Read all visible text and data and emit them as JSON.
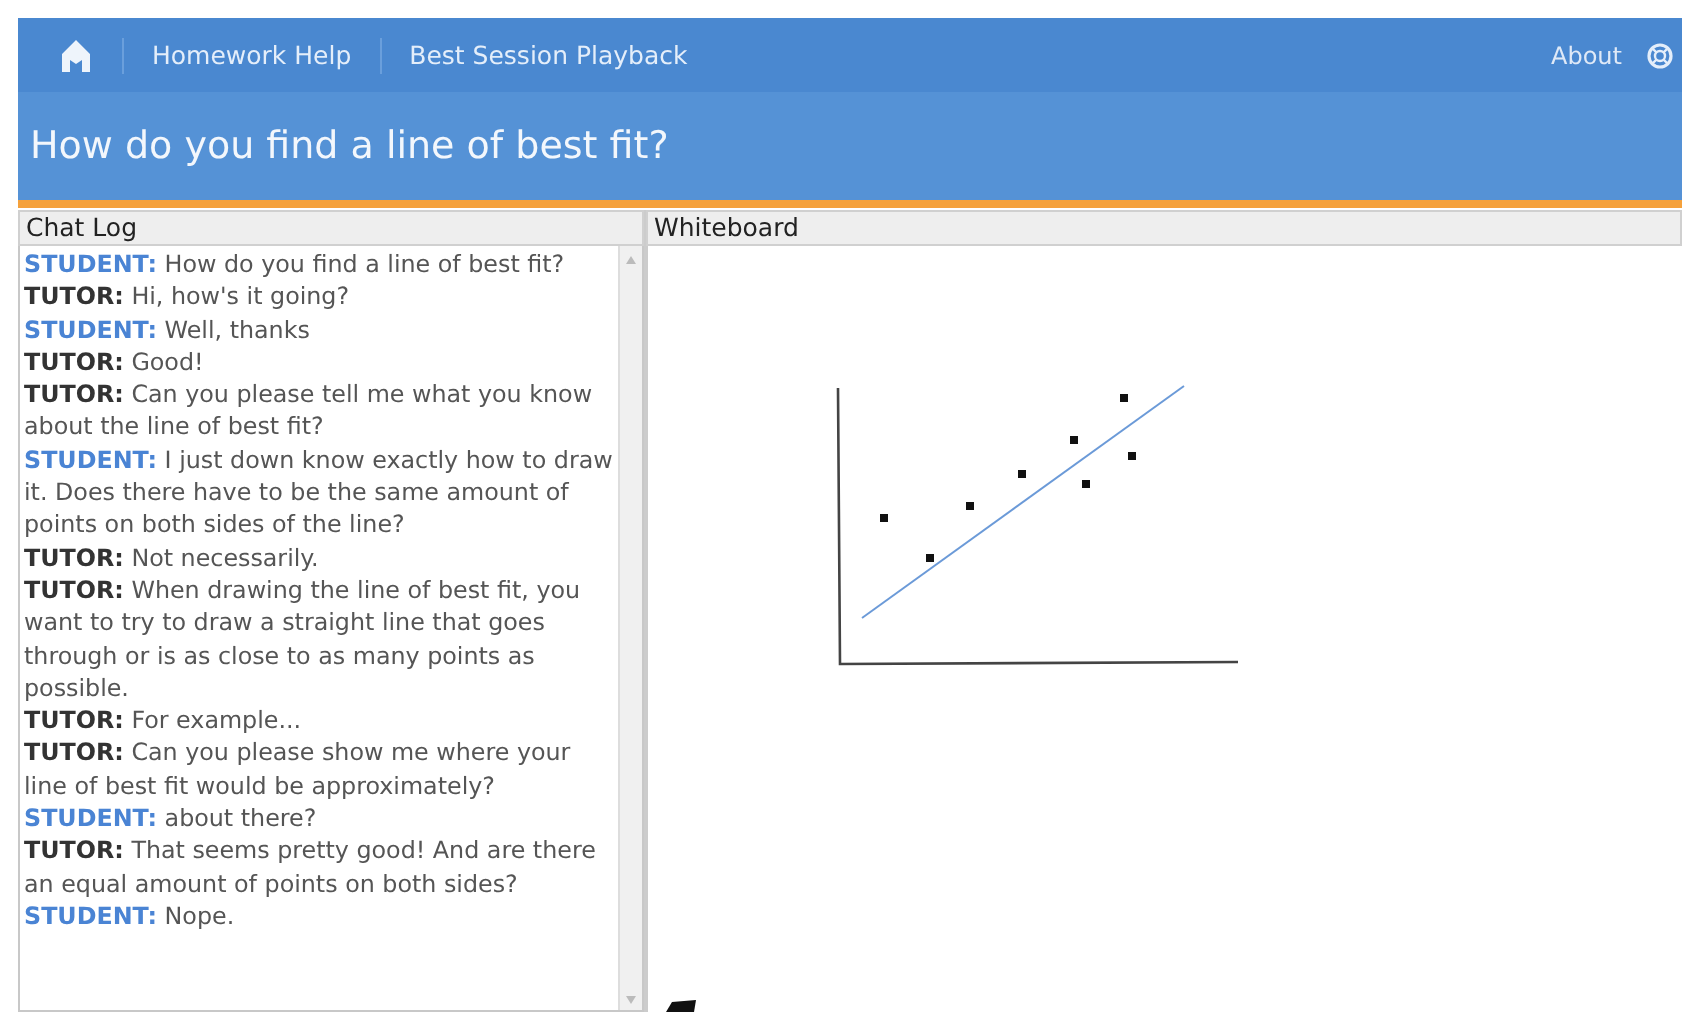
{
  "nav": {
    "links": [
      "Homework Help",
      "Best Session Playback"
    ],
    "about": "About"
  },
  "title": "How do you find a line of best fit?",
  "chat_log": {
    "heading": "Chat Log",
    "messages": [
      {
        "kind": "student",
        "speaker": "STUDENT:",
        "text": "How do you find a line of best fit?"
      },
      {
        "kind": "tutor",
        "speaker": "TUTOR:",
        "text": "Hi, how's it going?"
      },
      {
        "kind": "student",
        "speaker": "STUDENT:",
        "text": "Well, thanks"
      },
      {
        "kind": "tutor",
        "speaker": "TUTOR:",
        "text": "Good!"
      },
      {
        "kind": "tutor",
        "speaker": "TUTOR:",
        "text": "Can you please tell me what you know about the line of best fit?"
      },
      {
        "kind": "student",
        "speaker": "STUDENT:",
        "text": "I just down know exactly how to draw it. Does there have to be the same amount of points on both sides of the line?"
      },
      {
        "kind": "tutor",
        "speaker": "TUTOR:",
        "text": "Not necessarily."
      },
      {
        "kind": "tutor",
        "speaker": "TUTOR:",
        "text": "When drawing the line of best fit, you want to try to draw a straight line that goes through or is as close to as many points as possible."
      },
      {
        "kind": "tutor",
        "speaker": "TUTOR:",
        "text": "For example..."
      },
      {
        "kind": "tutor",
        "speaker": "TUTOR:",
        "text": "Can you please show me where your line of best fit would be approximately?"
      },
      {
        "kind": "student",
        "speaker": "STUDENT:",
        "text": "about there?"
      },
      {
        "kind": "tutor",
        "speaker": "TUTOR:",
        "text": "That seems pretty good! And are there an equal amount of points on both sides?"
      },
      {
        "kind": "student",
        "speaker": "STUDENT:",
        "text": "Nope."
      }
    ]
  },
  "whiteboard": {
    "heading": "Whiteboard"
  }
}
